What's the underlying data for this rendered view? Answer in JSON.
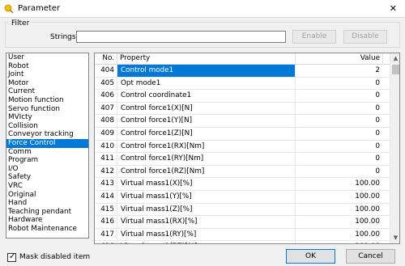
{
  "window": {
    "title": "Parameter",
    "close_glyph": "✕"
  },
  "filter": {
    "legend": "Filter",
    "strings_label": "Strings",
    "strings_value": "",
    "enable_label": "Enable",
    "disable_label": "Disable"
  },
  "categories": [
    {
      "label": "User",
      "selected": false
    },
    {
      "label": "Robot",
      "selected": false
    },
    {
      "label": "Joint",
      "selected": false
    },
    {
      "label": "Motor",
      "selected": false
    },
    {
      "label": "Current",
      "selected": false
    },
    {
      "label": "Motion function",
      "selected": false
    },
    {
      "label": "Servo function",
      "selected": false
    },
    {
      "label": "MVIcty",
      "selected": false
    },
    {
      "label": "Collision",
      "selected": false
    },
    {
      "label": "Conveyor tracking",
      "selected": false
    },
    {
      "label": "Force Control",
      "selected": true
    },
    {
      "label": "Comm",
      "selected": false
    },
    {
      "label": "Program",
      "selected": false
    },
    {
      "label": "I/O",
      "selected": false
    },
    {
      "label": "Safety",
      "selected": false
    },
    {
      "label": "VRC",
      "selected": false
    },
    {
      "label": "Original",
      "selected": false
    },
    {
      "label": "Hand",
      "selected": false
    },
    {
      "label": "Teaching pendant",
      "selected": false
    },
    {
      "label": "Hardware",
      "selected": false
    },
    {
      "label": "Robot Maintenance",
      "selected": false
    }
  ],
  "table": {
    "headers": {
      "no": "No.",
      "property": "Property",
      "value": "Value"
    },
    "rows": [
      {
        "no": "404",
        "property": "Control mode1",
        "value": "2",
        "selected": true
      },
      {
        "no": "405",
        "property": "Opt mode1",
        "value": "0",
        "selected": false
      },
      {
        "no": "406",
        "property": "Control coordinate1",
        "value": "0",
        "selected": false
      },
      {
        "no": "407",
        "property": "Control force1(X)[N]",
        "value": "0",
        "selected": false
      },
      {
        "no": "408",
        "property": "Control force1(Y)[N]",
        "value": "0",
        "selected": false
      },
      {
        "no": "409",
        "property": "Control force1(Z)[N]",
        "value": "0",
        "selected": false
      },
      {
        "no": "410",
        "property": "Control force1(RX)[Nm]",
        "value": "0",
        "selected": false
      },
      {
        "no": "411",
        "property": "Control force1(RY)[Nm]",
        "value": "0",
        "selected": false
      },
      {
        "no": "412",
        "property": "Control force1(RZ)[Nm]",
        "value": "0",
        "selected": false
      },
      {
        "no": "413",
        "property": "Virtual mass1(X)[%]",
        "value": "100.00",
        "selected": false
      },
      {
        "no": "414",
        "property": "Virtual mass1(Y)[%]",
        "value": "100.00",
        "selected": false
      },
      {
        "no": "415",
        "property": "Virtual mass1(Z)[%]",
        "value": "100.00",
        "selected": false
      },
      {
        "no": "416",
        "property": "Virtual mass1(RX)[%]",
        "value": "100.00",
        "selected": false
      },
      {
        "no": "417",
        "property": "Virtual mass1(RY)[%]",
        "value": "100.00",
        "selected": false
      },
      {
        "no": "418",
        "property": "Virtual mass1(RZ)[%]",
        "value": "100.00",
        "selected": false
      },
      {
        "no": "419",
        "property": "Virtual damper1(X)[%]",
        "value": "100.00",
        "selected": false
      }
    ]
  },
  "footer": {
    "mask_label": "Mask disabled item",
    "mask_checked": true,
    "ok_label": "OK",
    "cancel_label": "Cancel"
  },
  "colors": {
    "selection": "#0078d7",
    "icon": "#f5c000"
  }
}
